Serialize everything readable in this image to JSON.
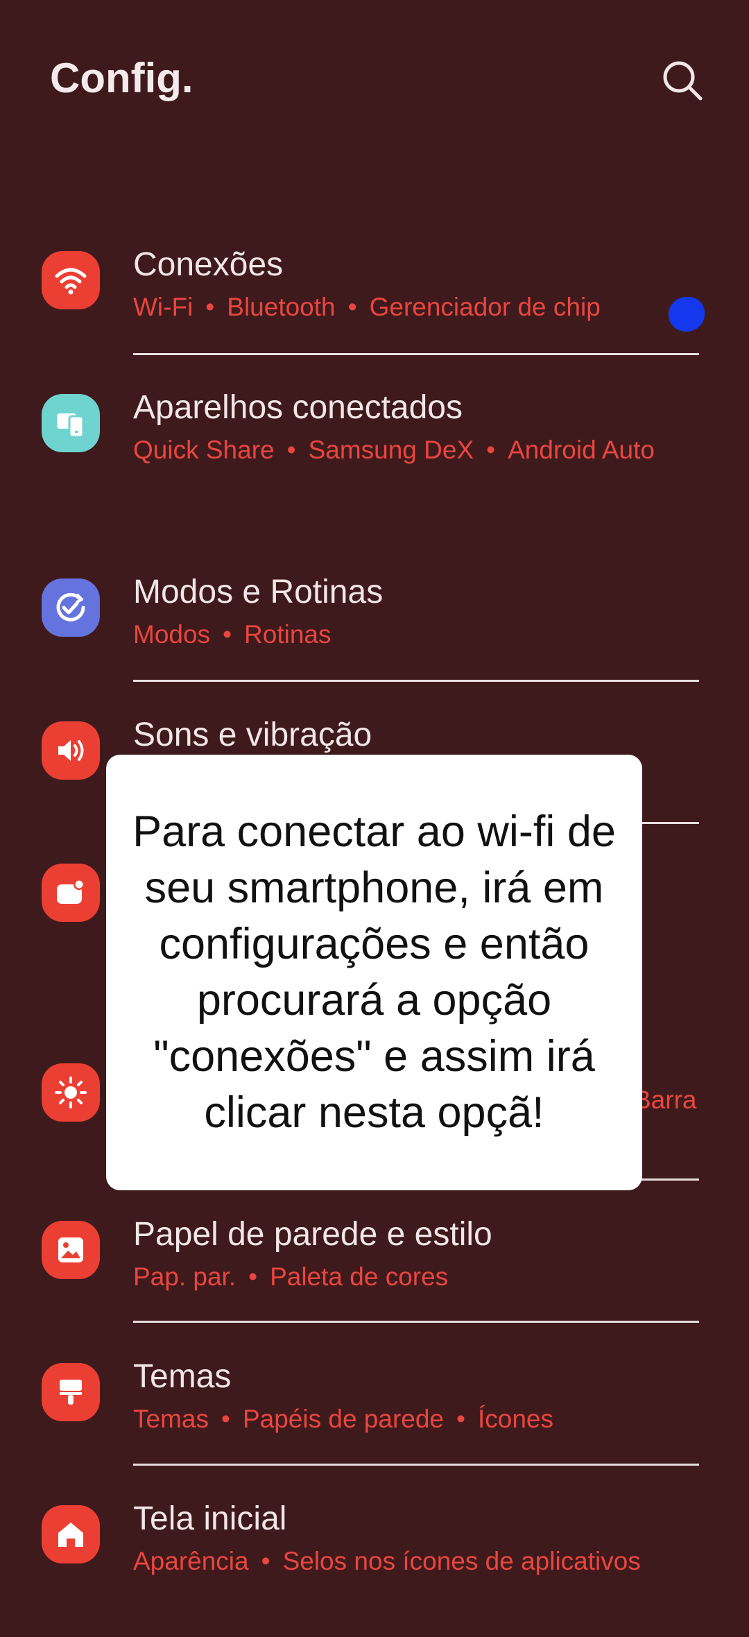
{
  "header": {
    "title": "Config.",
    "search_icon": "search-icon"
  },
  "items": [
    {
      "title": "Conexões",
      "sub": [
        "Wi-Fi",
        "Bluetooth",
        "Gerenciador de chip"
      ],
      "icon": "wifi-icon",
      "color": "#ec3f33"
    },
    {
      "title": "Aparelhos conectados",
      "sub": [
        "Quick Share",
        "Samsung DeX",
        "Android Auto"
      ],
      "icon": "devices-icon",
      "color": "#6fd3cf"
    },
    {
      "title": "Modos e Rotinas",
      "sub": [
        "Modos",
        "Rotinas"
      ],
      "icon": "routine-check-icon",
      "color": "#6473dd"
    },
    {
      "title": "Sons e vibração",
      "sub": [],
      "icon": "speaker-icon",
      "color": "#ec3f33"
    },
    {
      "title": "",
      "sub": [],
      "icon": "notifications-icon",
      "color": "#ec3f33"
    },
    {
      "title": "",
      "sub": [
        "Barra"
      ],
      "icon": "brightness-icon",
      "color": "#ec3f33"
    },
    {
      "title": "Papel de parede e estilo",
      "sub": [
        "Pap. par.",
        "Paleta de cores"
      ],
      "icon": "wallpaper-icon",
      "color": "#ec3f33"
    },
    {
      "title": "Temas",
      "sub": [
        "Temas",
        "Papéis de parede",
        "Ícones"
      ],
      "icon": "themes-brush-icon",
      "color": "#ec3f33"
    },
    {
      "title": "Tela inicial",
      "sub": [
        "Aparência",
        "Selos nos ícones de aplicativos"
      ],
      "icon": "home-icon",
      "color": "#ec3f33"
    }
  ],
  "overlay": {
    "text": "Para conectar ao wi-fi de seu smartphone, irá em configurações e então procurará a opção \"conexões\" e assim irá clicar nesta opçã!"
  },
  "colors": {
    "background": "#3f1a1c",
    "accent_text": "#e8463f",
    "tap_marker": "#1438ee"
  }
}
